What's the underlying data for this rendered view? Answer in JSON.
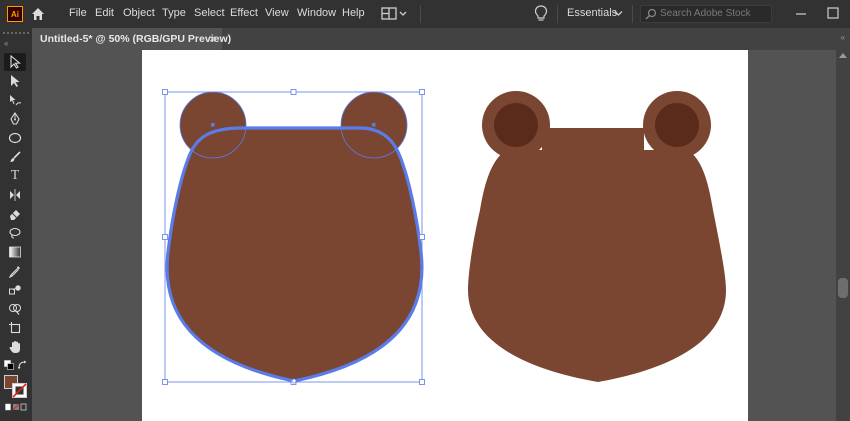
{
  "app": {
    "logo_text": "Ai",
    "menu": [
      "File",
      "Edit",
      "Object",
      "Type",
      "Select",
      "Effect",
      "View",
      "Window",
      "Help"
    ],
    "workspace_label": "Essentials",
    "search_placeholder": "Search Adobe Stock"
  },
  "document": {
    "tab_title": "Untitled-5* @ 50% (RGB/GPU Preview)",
    "close_glyph": "×"
  },
  "toolbar": {
    "collapse_glyph": "«",
    "type_tool_glyph": "T",
    "tools": [
      "selection-tool",
      "direct-selection-tool",
      "curvature-tool",
      "pen-tool",
      "ellipse-tool",
      "paintbrush-tool",
      "type-tool",
      "width-tool",
      "eraser-tool",
      "lasso-tool",
      "gradient-tool",
      "eyedropper-tool",
      "blend-tool",
      "shape-builder-tool",
      "artboard-tool",
      "hand-tool",
      "fill-stroke-swap",
      "default-colors",
      "fill-swatch",
      "stroke-swatch",
      "drawing-modes"
    ]
  },
  "panel_collapse_glyph": "«",
  "colors": {
    "face": "#7a4631",
    "inner_ear": "#5a2a1a",
    "selection": "#5b7ce8",
    "artboard": "#ffffff",
    "app_bg": "#535353",
    "ai_orange": "#ff9a00"
  }
}
